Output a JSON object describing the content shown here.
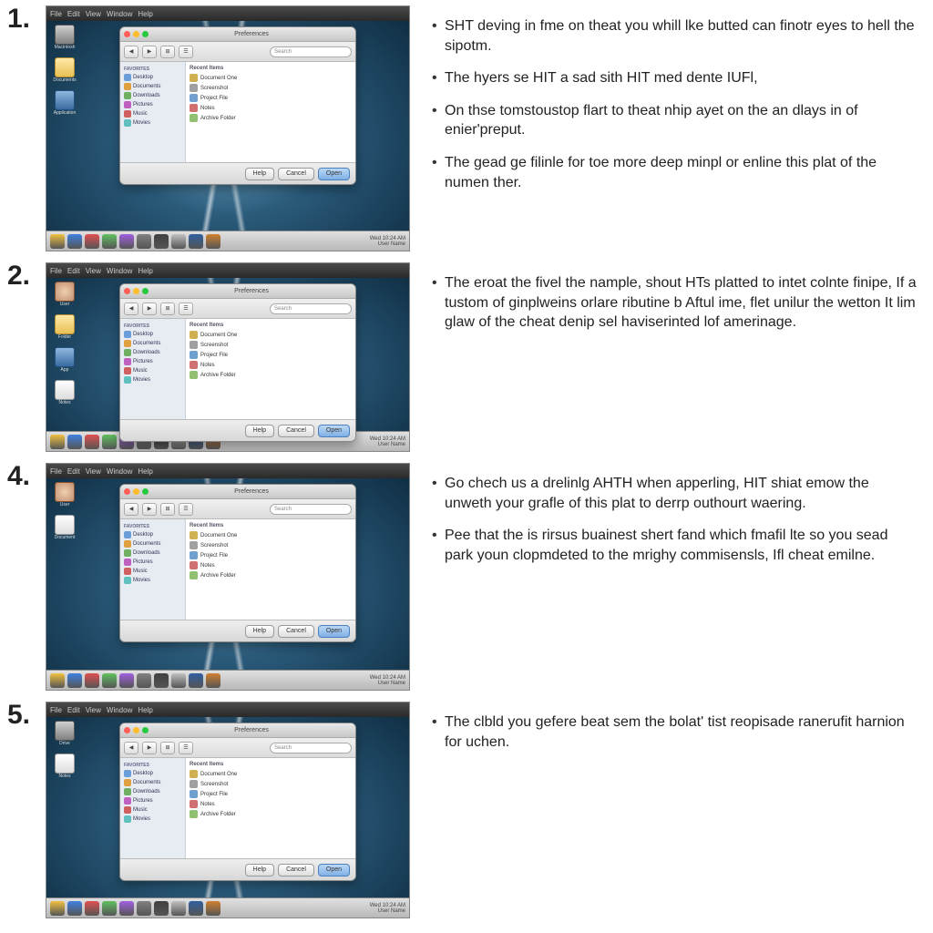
{
  "steps": [
    {
      "num": "1.",
      "bullets": [
        "SHT deving in fme on theat you whill lke butted can finotr eyes to hell the sipotm.",
        "The hyers se HIT a sad sith HIT med dente IUFl,",
        "On thse tomstoustop flart to theat nhip ayet on the an dlays in of enier'preput.",
        "The gead ge filinle for toe more deep minpl or enline this plat of the numen ther."
      ]
    },
    {
      "num": "2.",
      "bullets": [
        "The eroat the fivel the nample, shout HTs platted to intet colnte finipe, If a tustom of ginplweins orlare ributine b Aftul ime, flet unilur the wetton It lim glaw of the cheat denip sel haviserinted lof amerinage."
      ]
    },
    {
      "num": "4.",
      "bullets": [
        "Go chech us a drelinlg AHTH when apperling, HIT shiat emow the unweth your grafle of this plat to derrp outhourt waering.",
        "Pee that the is rirsus buainest shert fand which fmafil lte so you sead park youn clopmdeted to the mrighy commisensls, Ifl cheat emilne."
      ]
    },
    {
      "num": "5.",
      "bullets": [
        "The clbld you gefere beat sem the bolat' tist reopisade ranerufit harnion for uchen."
      ]
    }
  ],
  "menubar": [
    "File",
    "Edit",
    "View",
    "Window",
    "Help"
  ],
  "desk_icons": [
    {
      "label": "Macintosh",
      "cls": "g-disk"
    },
    {
      "label": "Documents",
      "cls": "g-folder"
    },
    {
      "label": "Application",
      "cls": "g-app"
    }
  ],
  "dialog": {
    "title": "Preferences",
    "toolbar": [
      "◀",
      "▶",
      "⊞",
      "☰"
    ],
    "search": "Search",
    "side_header": "Favorites",
    "side": [
      "Desktop",
      "Documents",
      "Downloads",
      "Pictures",
      "Music",
      "Movies"
    ],
    "main_header": "Recent Items",
    "main": [
      "Document One",
      "Screenshot",
      "Project File",
      "Notes",
      "Archive Folder"
    ],
    "buttons": {
      "primary": "Open",
      "secondary": "Cancel",
      "tertiary": "Help"
    }
  },
  "taskbar_status": [
    "Wed 10:24 AM",
    "User Name"
  ]
}
